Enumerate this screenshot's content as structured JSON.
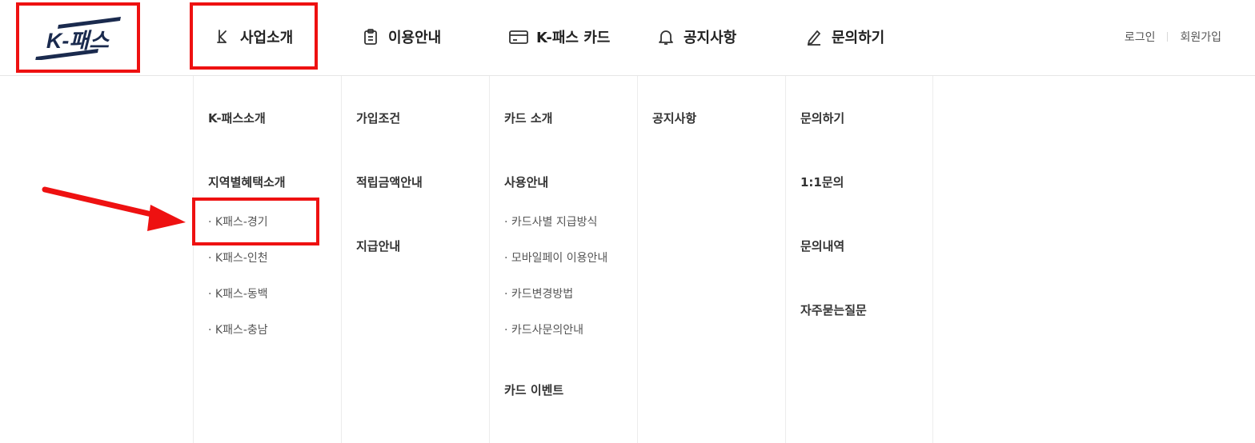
{
  "header": {
    "logo_text": "K-패스",
    "nav": [
      {
        "label": "사업소개",
        "icon": "k-logo-mark-icon"
      },
      {
        "label": "이용안내",
        "icon": "clipboard-icon"
      },
      {
        "label": "K-패스 카드",
        "icon": "card-icon"
      },
      {
        "label": "공지사항",
        "icon": "bell-icon"
      },
      {
        "label": "문의하기",
        "icon": "pencil-icon"
      }
    ],
    "util": {
      "login": "로그인",
      "signup": "회원가입"
    }
  },
  "menu": {
    "business": {
      "intro": "K-패스소개",
      "regional": "지역별혜택소개",
      "subs": [
        "· K패스-경기",
        "· K패스-인천",
        "· K패스-동백",
        "· K패스-충남"
      ]
    },
    "usage": {
      "items": [
        "가입조건",
        "적립금액안내",
        "지급안내"
      ]
    },
    "card": {
      "intro": "카드 소개",
      "usage": "사용안내",
      "subs": [
        "· 카드사별 지급방식",
        "· 모바일페이 이용안내",
        "· 카드변경방법",
        "· 카드사문의안내"
      ],
      "event": "카드 이벤트"
    },
    "notice": {
      "items": [
        "공지사항"
      ]
    },
    "inquiry": {
      "items": [
        "문의하기",
        "1:1문의",
        "문의내역",
        "자주묻는질문"
      ]
    }
  },
  "colors": {
    "highlight": "#ee1111",
    "logo_navy": "#1a2a4e",
    "text": "#222222"
  }
}
